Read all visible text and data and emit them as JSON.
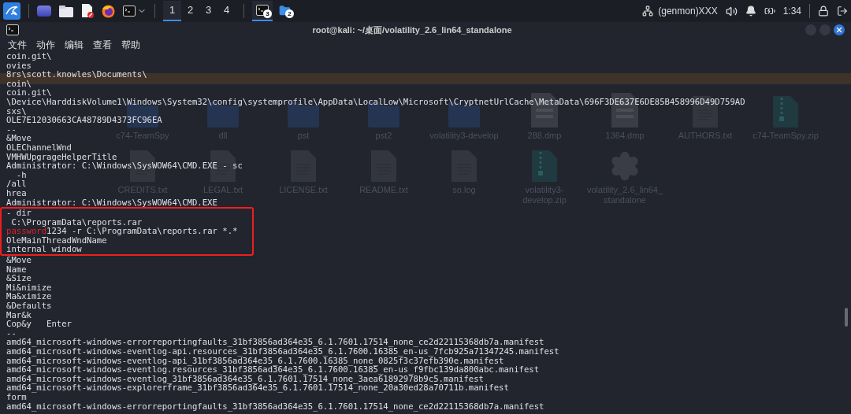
{
  "taskbar": {
    "launchers": [
      {
        "kind": "workspace"
      },
      {
        "kind": "files"
      },
      {
        "kind": "document"
      },
      {
        "kind": "browser"
      },
      {
        "kind": "terminal"
      }
    ],
    "workspaces": [
      {
        "label": "1",
        "selected": true
      },
      {
        "label": "2",
        "selected": false
      },
      {
        "label": "3",
        "selected": false
      },
      {
        "label": "4",
        "selected": false
      }
    ],
    "tasks": [
      {
        "kind": "terminal",
        "count": "3",
        "selected": true
      },
      {
        "kind": "folder",
        "count": "2",
        "selected": false
      }
    ],
    "genmon": "(genmon)XXX",
    "clock": "1:34"
  },
  "window": {
    "title": "root@kali: ~/桌面/volatility_2.6_lin64_standalone",
    "menu": [
      "文件",
      "动作",
      "编辑",
      "查看",
      "帮助"
    ]
  },
  "background_files": [
    {
      "name": "c74-TeamSpy",
      "kind": "folder"
    },
    {
      "name": "dll",
      "kind": "folder"
    },
    {
      "name": "pst",
      "kind": "folder"
    },
    {
      "name": "pst2",
      "kind": "folder"
    },
    {
      "name": "volatility3-develop",
      "kind": "folder"
    },
    {
      "name": "288.dmp",
      "kind": "binary"
    },
    {
      "name": "1364.dmp",
      "kind": "binary"
    },
    {
      "name": "AUTHORS.txt",
      "kind": "text"
    },
    {
      "name": "c74-TeamSpy.zip",
      "kind": "zip"
    },
    {
      "name": "CREDITS.txt",
      "kind": "text"
    },
    {
      "name": "LEGAL.txt",
      "kind": "text"
    },
    {
      "name": "LICENSE.txt",
      "kind": "text"
    },
    {
      "name": "README.txt",
      "kind": "text"
    },
    {
      "name": "so.log",
      "kind": "text"
    },
    {
      "name": "volatility3-develop.zip",
      "kind": "zip"
    },
    {
      "name": "volatility_2.6_lin64_standalone",
      "kind": "gear"
    }
  ],
  "terminal": {
    "lines_before": [
      {
        "text": "coin.git\\"
      },
      {
        "text": "ovies"
      },
      {
        "text": "8rs\\scott.knowles\\Documents\\"
      },
      {
        "text": "coin\\"
      },
      {
        "text": "coin.git\\"
      },
      {
        "text": "\\Device\\HarddiskVolume1\\Windows\\System32\\config\\systemprofile\\AppData\\LocalLow\\Microsoft\\CryptnetUrlCache\\MetaData\\696F3DE637E6DE85B458996D49D759AD"
      },
      {
        "text": "sxs\\"
      },
      {
        "text": "OLE7E12030663CA48789D4373FC96EA"
      },
      {
        "text": "--"
      },
      {
        "text": "&Move"
      },
      {
        "text": "OLEChannelWnd"
      },
      {
        "text": "VMHWUpgrageHelperTitle"
      },
      {
        "text": "Administrator: C:\\Windows\\SysWOW64\\CMD.EXE - sc"
      },
      {
        "text": "  -h"
      },
      {
        "text": "/all"
      },
      {
        "text": "hrea"
      },
      {
        "text": "Administrator: C:\\Windows\\SysWOW64\\CMD.EXE"
      }
    ],
    "highlighted": [
      {
        "parts": [
          {
            "text": "- dir"
          }
        ]
      },
      {
        "parts": [
          {
            "text": " C:\\ProgramData\\reports.rar"
          }
        ]
      },
      {
        "parts": [
          {
            "text": "password",
            "color": "#e0202a"
          },
          {
            "text": "1234 -r C:\\ProgramData\\reports.rar *.*"
          }
        ]
      },
      {
        "parts": [
          {
            "text": "OleMainThreadWndName"
          }
        ]
      },
      {
        "parts": [
          {
            "text": "internal window"
          }
        ]
      }
    ],
    "lines_after": [
      {
        "text": "&Move"
      },
      {
        "text": "Name"
      },
      {
        "text": "&Size"
      },
      {
        "text": "Mi&nimize"
      },
      {
        "text": "Ma&ximize"
      },
      {
        "text": "&Defaults"
      },
      {
        "text": "Mar&k"
      },
      {
        "text": "Cop&y   Enter"
      },
      {
        "text": "--"
      },
      {
        "text": "amd64_microsoft-windows-errorreportingfaults_31bf3856ad364e35_6.1.7601.17514_none_ce2d22115368db7a.manifest"
      },
      {
        "text": "amd64_microsoft-windows-eventlog-api.resources_31bf3856ad364e35_6.1.7600.16385_en-us_7fcb925a71347245.manifest"
      },
      {
        "text": "amd64_microsoft-windows-eventlog-api_31bf3856ad364e35_6.1.7600.16385_none_0825f3c37efb390e.manifest"
      },
      {
        "text": "amd64_microsoft-windows-eventlog.resources_31bf3856ad364e35_6.1.7600.16385_en-us_f9fbc139da800abc.manifest"
      },
      {
        "text": "amd64_microsoft-windows-eventlog_31bf3856ad364e35_6.1.7601.17514_none_3aea61892978b9c5.manifest"
      },
      {
        "text": "amd64_microsoft-windows-explorerframe_31bf3856ad364e35_6.1.7601.17514_none_20a30ed28a70711b.manifest"
      },
      {
        "text": "form"
      },
      {
        "text": "amd64_microsoft-windows-errorreportingfaults_31bf3856ad364e35_6.1.7601.17514_none_ce2d22115368db7a.manifest"
      }
    ]
  }
}
